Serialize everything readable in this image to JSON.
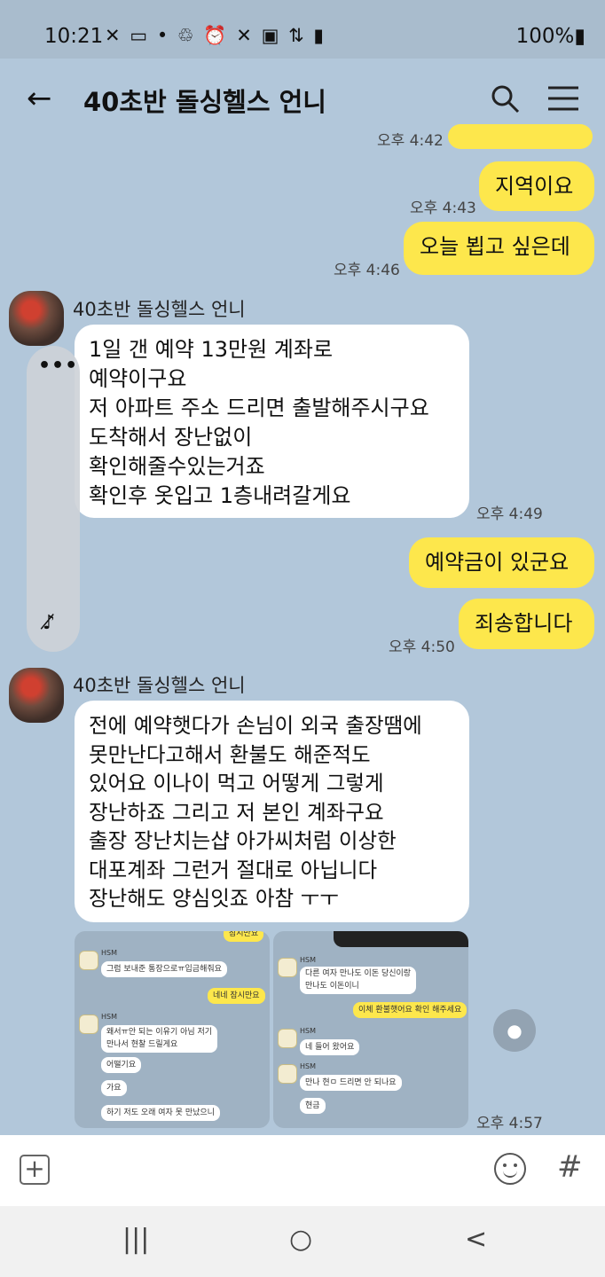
{
  "status_bar": {
    "time": "10:21",
    "icons": [
      "no-signal-icon",
      "citi-icon",
      "dot-icon",
      "recycle-icon",
      "alarm-icon",
      "mute-icon",
      "hd-icon",
      "5g-icon",
      "signal-icon"
    ],
    "battery": "100%"
  },
  "header": {
    "title": "40초반 돌싱헬스 언니"
  },
  "messages": {
    "partial_ts": "오후 4:42",
    "m1": {
      "text": "지역이요",
      "time": "오후 4:43"
    },
    "m2": {
      "text": "오늘 뵙고 싶은데",
      "time": "오후 4:46"
    },
    "g1": {
      "sender": "40초반 돌싱헬스 언니",
      "lines": [
        "1일 갠 예약 13만원 계좌로",
        "예약이구요",
        "저 아파트 주소 드리면 출발해주시구요",
        "도착해서 장난없이",
        "확인해줄수있는거죠",
        "확인후 옷입고 1층내려갈게요"
      ],
      "time": "오후 4:49"
    },
    "m3": {
      "text": "예약금이 있군요"
    },
    "m4": {
      "text": "죄송합니다",
      "time": "오후 4:50"
    },
    "g2": {
      "sender": "40초반 돌싱헬스 언니",
      "lines": [
        "전에 예약햇다가 손님이 외국 출장땜에",
        "못만난다고해서 환불도 해준적도",
        "있어요 이나이 먹고 어떻게 그렇게",
        "장난하죠 그리고 저 본인 계좌구요",
        "출장 장난치는샵 아가씨처럼 이상한",
        "대포계좌 그런거 절대로 아닙니다",
        "장난해도 양심잇죠 아참 ㅜㅜ"
      ],
      "image_time": "오후 4:57"
    },
    "left_shot": {
      "name": "HSM",
      "top_yellow": "잠시만요",
      "line1": "그럼 보내준 통장으로ㅠ입금해줘요",
      "yellow1": "네네 잠시만요",
      "line2a": "왜서ㅠ안 되는 이유기 아님 저기",
      "line2b": "만나서 현찰 드릴게요",
      "line3": "어떨기요",
      "line4": "가요",
      "line5": "하기 저도 오래 여자 못 만났으니"
    },
    "right_shot": {
      "name": "HSM",
      "line1a": "다른 여자 만나도 이돈 당신이랑",
      "line1b": "만나도 이돈이니",
      "yellow1": "이체 환불햇어요 확인 해주세요",
      "line2": "네 들어 왔어요",
      "line3": "만나 현ㅁ 드리면 안 되나요",
      "line4": "현금"
    }
  },
  "input_bar": {
    "icons": [
      "plus-icon",
      "emoji-icon",
      "hashtag-icon"
    ]
  },
  "nav_bar": {
    "recents": "|||",
    "home": "○",
    "back": "<"
  },
  "colors": {
    "background": "#b2c7da",
    "my_bubble": "#fde74c",
    "their_bubble": "#ffffff"
  }
}
